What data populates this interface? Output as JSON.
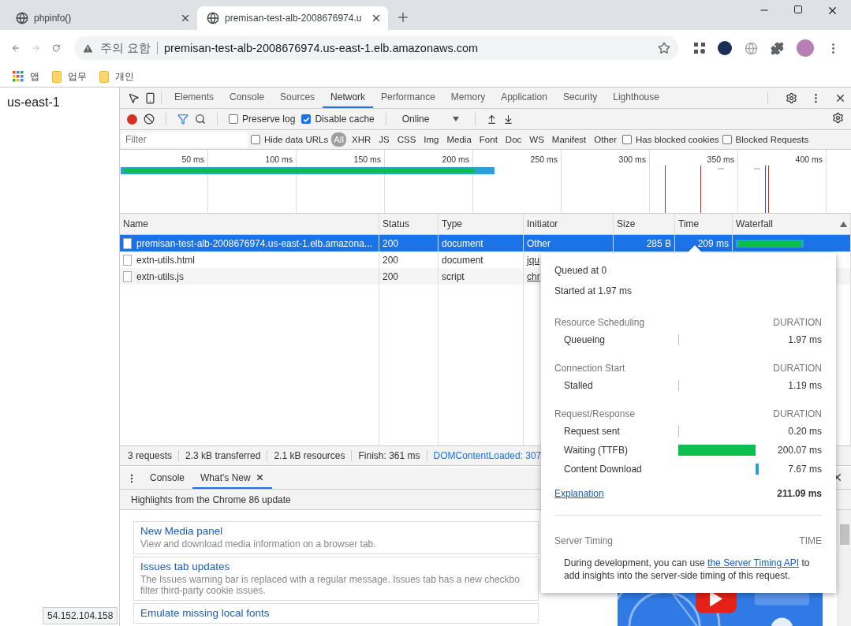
{
  "browser_tabs": [
    {
      "title": "phpinfo()",
      "selected": false
    },
    {
      "title": "premisan-test-alb-2008676974.u",
      "selected": true
    }
  ],
  "address_bar": {
    "security": "주의 요함",
    "url": "premisan-test-alb-2008676974.us-east-1.elb.amazonaws.com"
  },
  "bookmarks": [
    {
      "label": "앱",
      "kind": "apps"
    },
    {
      "label": "업무",
      "kind": "folder"
    },
    {
      "label": "개인",
      "kind": "folder"
    }
  ],
  "page": {
    "text": "us-east-1",
    "status_url": "54.152.104.158"
  },
  "devtools": {
    "panels": [
      {
        "label": "Elements",
        "selected": false
      },
      {
        "label": "Console",
        "selected": false
      },
      {
        "label": "Sources",
        "selected": false
      },
      {
        "label": "Network",
        "selected": true
      },
      {
        "label": "Performance",
        "selected": false
      },
      {
        "label": "Memory",
        "selected": false
      },
      {
        "label": "Application",
        "selected": false
      },
      {
        "label": "Security",
        "selected": false
      },
      {
        "label": "Lighthouse",
        "selected": false
      }
    ],
    "toolbar": {
      "preserve_log": {
        "label": "Preserve log",
        "checked": false
      },
      "disable_cache": {
        "label": "Disable cache",
        "checked": true
      },
      "throttling": "Online"
    },
    "filter": {
      "placeholder": "Filter",
      "hide_data_urls": {
        "label": "Hide data URLs",
        "checked": false
      },
      "types": [
        {
          "label": "All",
          "selected": true
        },
        {
          "label": "XHR",
          "selected": false
        },
        {
          "label": "JS",
          "selected": false
        },
        {
          "label": "CSS",
          "selected": false
        },
        {
          "label": "Img",
          "selected": false
        },
        {
          "label": "Media",
          "selected": false
        },
        {
          "label": "Font",
          "selected": false
        },
        {
          "label": "Doc",
          "selected": false
        },
        {
          "label": "WS",
          "selected": false
        },
        {
          "label": "Manifest",
          "selected": false
        },
        {
          "label": "Other",
          "selected": false
        }
      ],
      "has_blocked_cookies": {
        "label": "Has blocked cookies",
        "checked": false
      },
      "blocked_requests": {
        "label": "Blocked Requests",
        "checked": false
      }
    },
    "overview": {
      "ticks": [
        "50 ms",
        "100 ms",
        "150 ms",
        "200 ms",
        "250 ms",
        "300 ms",
        "350 ms",
        "400 ms"
      ]
    },
    "table": {
      "columns": [
        "Name",
        "Status",
        "Type",
        "Initiator",
        "Size",
        "Time",
        "Waterfall"
      ],
      "rows": [
        {
          "name": "premisan-test-alb-2008676974.us-east-1.elb.amazona...",
          "status": "200",
          "type": "document",
          "initiator": "Other",
          "size": "285 B",
          "time": "209 ms",
          "selected": true
        },
        {
          "name": "extn-utils.html",
          "status": "200",
          "type": "document",
          "initiator": "jqu",
          "selected": false
        },
        {
          "name": "extn-utils.js",
          "status": "200",
          "type": "script",
          "initiator": "chr",
          "selected": false
        }
      ]
    },
    "summary": [
      {
        "text": "3 requests",
        "kind": "plain"
      },
      {
        "text": "2.3 kB transferred",
        "kind": "plain"
      },
      {
        "text": "2.1 kB resources",
        "kind": "plain"
      },
      {
        "text": "Finish: 361 ms",
        "kind": "plain"
      },
      {
        "text": "DOMContentLoaded: 307",
        "kind": "dom"
      }
    ],
    "drawer": {
      "tabs": [
        {
          "label": "Console",
          "selected": false,
          "closable": false
        },
        {
          "label": "What's New",
          "selected": true,
          "closable": true
        }
      ],
      "heading": "Highlights from the Chrome 86 update",
      "cards": [
        {
          "title": "New Media panel",
          "lines": [
            "View and download media information on a browser tab."
          ]
        },
        {
          "title": "Issues tab updates",
          "lines": [
            "The Issues warning bar is replaced with a regular message. Issues tab has a new checkbo",
            "filter third-party cookie issues."
          ]
        },
        {
          "title": "Emulate missing local fonts"
        }
      ]
    },
    "timing_popover": {
      "queued": "Queued at 0",
      "started": "Started at 1.97 ms",
      "sections": [
        {
          "title": "Resource Scheduling",
          "header": "DURATION",
          "rows": [
            {
              "label": "Queueing",
              "value": "1.97 ms",
              "kind": "tick"
            }
          ]
        },
        {
          "title": "Connection Start",
          "header": "DURATION",
          "rows": [
            {
              "label": "Stalled",
              "value": "1.19 ms",
              "kind": "tick"
            }
          ]
        },
        {
          "title": "Request/Response",
          "header": "DURATION",
          "rows": [
            {
              "label": "Request sent",
              "value": "0.20 ms",
              "kind": "tick"
            },
            {
              "label": "Waiting (TTFB)",
              "value": "200.07 ms",
              "kind": "wait"
            },
            {
              "label": "Content Download",
              "value": "7.67 ms",
              "kind": "download"
            }
          ]
        }
      ],
      "explanation": "Explanation",
      "total": "211.09 ms",
      "server_timing": {
        "title": "Server Timing",
        "header": "TIME",
        "text_before": "During development, you can use ",
        "link": "the Server Timing API",
        "text_after": " to add insights into the server-side timing of this request."
      }
    }
  }
}
